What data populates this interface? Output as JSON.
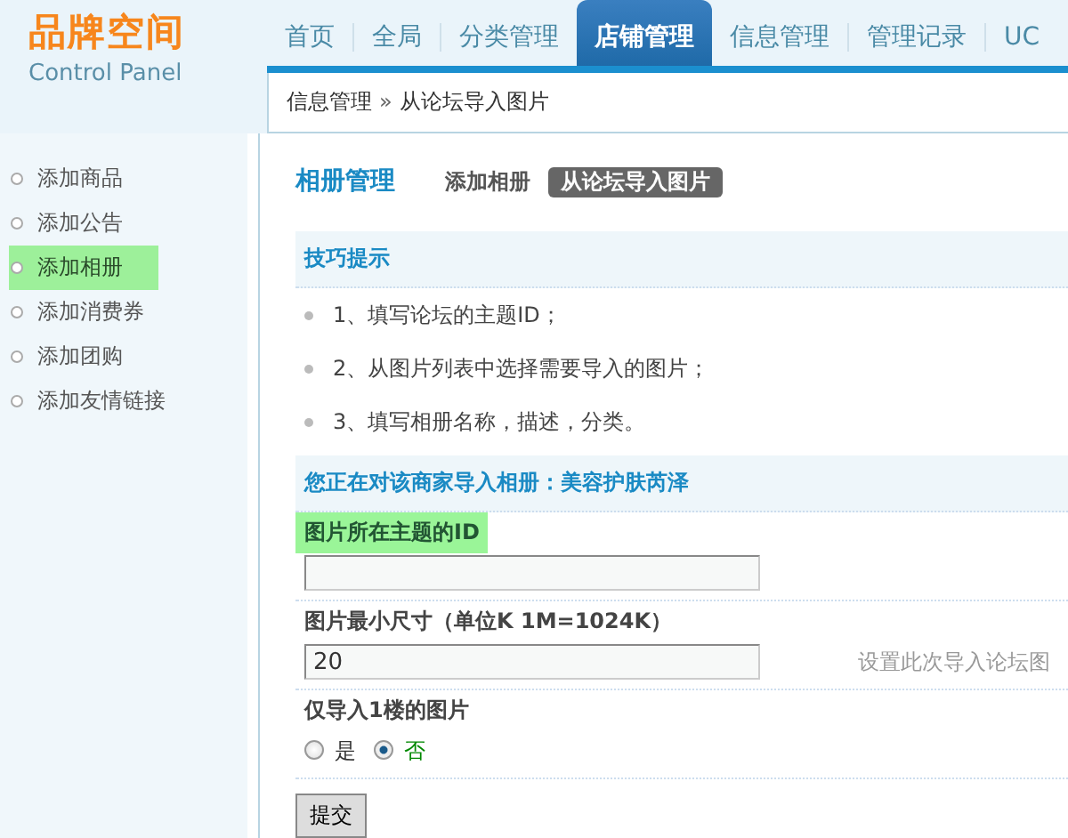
{
  "logo": {
    "title": "品牌空间",
    "subtitle": "Control Panel"
  },
  "nav": [
    {
      "label": "首页",
      "selected": false
    },
    {
      "label": "全局",
      "selected": false
    },
    {
      "label": "分类管理",
      "selected": false
    },
    {
      "label": "店铺管理",
      "selected": true
    },
    {
      "label": "信息管理",
      "selected": false
    },
    {
      "label": "管理记录",
      "selected": false
    },
    {
      "label": "UC",
      "selected": false
    }
  ],
  "breadcrumb": {
    "parent": "信息管理",
    "separator": "»",
    "current": "从论坛导入图片"
  },
  "sidebar": {
    "items": [
      {
        "label": "添加商品",
        "selected": false
      },
      {
        "label": "添加公告",
        "selected": false
      },
      {
        "label": "添加相册",
        "selected": true
      },
      {
        "label": "添加消费券",
        "selected": false
      },
      {
        "label": "添加团购",
        "selected": false
      },
      {
        "label": "添加友情链接",
        "selected": false
      }
    ]
  },
  "section": {
    "title": "相册管理",
    "tabs": [
      {
        "label": "添加相册",
        "selected": false
      },
      {
        "label": "从论坛导入图片",
        "selected": true
      }
    ]
  },
  "tips": {
    "title": "技巧提示",
    "items": [
      "1、填写论坛的主题ID；",
      "2、从图片列表中选择需要导入的图片；",
      "3、填写相册名称，描述，分类。"
    ]
  },
  "form": {
    "heading": "您正在对该商家导入相册：美容护肤芮泽",
    "fields": [
      {
        "kind": "text",
        "label": "图片所在主题的ID",
        "highlighted": true
      },
      {
        "kind": "text",
        "label": "图片最小尺寸（单位K 1M=1024K）",
        "highlighted": false,
        "value": "20",
        "hint": "设置此次导入论坛图"
      },
      {
        "kind": "radio",
        "label": "仅导入1楼的图片",
        "highlighted": false,
        "options": [
          {
            "label": "是",
            "selected": false
          },
          {
            "label": "否",
            "selected": true
          }
        ]
      }
    ],
    "submit": "提交"
  }
}
